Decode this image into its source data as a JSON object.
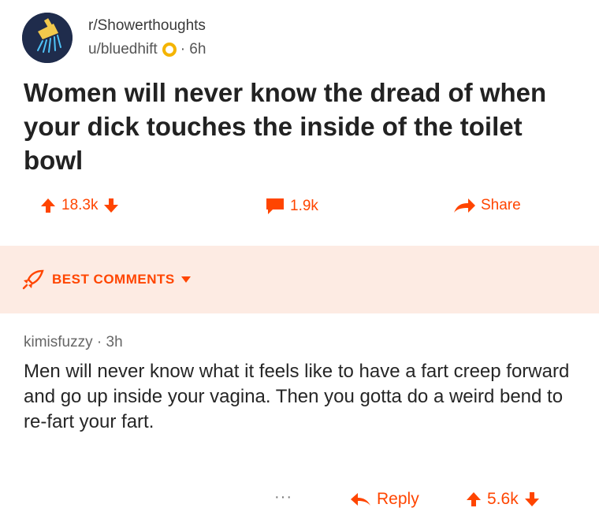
{
  "post": {
    "subreddit": "r/Showerthoughts",
    "author": "u/bluedhift",
    "age": "· 6h",
    "title": "Women will never know the dread of when your dick touches the inside of the toilet bowl",
    "upvotes": "18.3k",
    "comments": "1.9k",
    "share_label": "Share"
  },
  "sort": {
    "label": "BEST COMMENTS"
  },
  "comment": {
    "author": "kimisfuzzy",
    "age": "· 3h",
    "body": "Men will never know what it feels like to have a fart creep forward and go up inside your vagina. Then you gotta do a weird bend to re-fart your fart.",
    "more": "···",
    "reply_label": "Reply",
    "score": "5.6k"
  },
  "colors": {
    "accent": "#ff4500",
    "best_bar_bg": "#fdebe3",
    "title_text": "#222222",
    "avatar_bg": "#1f2c4c"
  },
  "icons": {
    "avatar": "showerhead-icon",
    "badge": "gold-award-icon",
    "upvote": "arrow-up-icon",
    "downvote": "arrow-down-icon",
    "comments": "speech-bubble-icon",
    "share": "share-arrow-icon",
    "sort": "rocket-icon",
    "reply": "reply-arrow-icon"
  }
}
